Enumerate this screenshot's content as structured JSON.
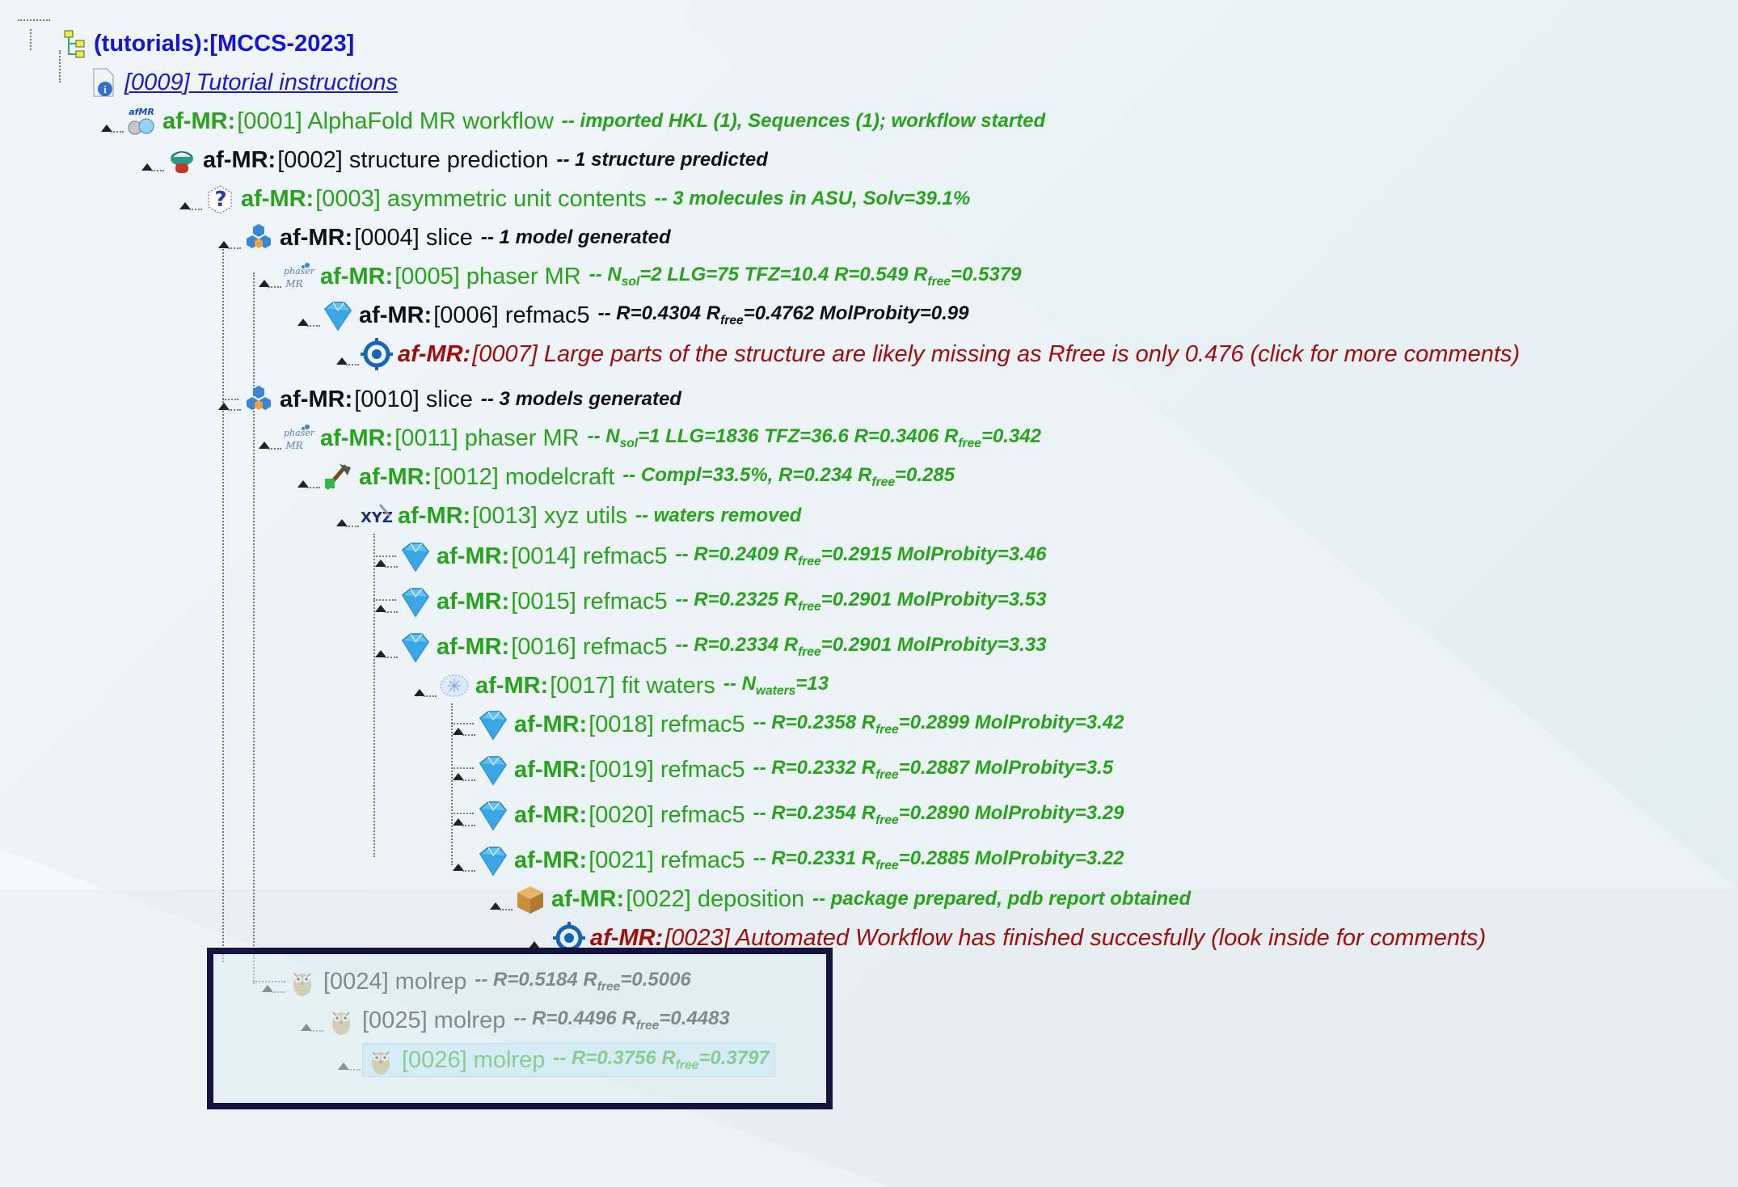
{
  "root": {
    "label": "(tutorials):[MCCS-2023]"
  },
  "instructions_link": {
    "label": "[0009] Tutorial instructions"
  },
  "nodes": [
    {
      "id": "0001",
      "prefix": "af-MR:",
      "title": "[0001] AlphaFold MR workflow",
      "sep": " -- ",
      "summary": "imported HKL (1), Sequences (1); workflow started",
      "color": "green",
      "icon": "afmr-icon"
    },
    {
      "id": "0002",
      "prefix": "af-MR:",
      "title": "[0002] structure prediction",
      "sep": " -- ",
      "summary": "1 structure predicted",
      "color": "black",
      "icon": "structure-prediction-icon"
    },
    {
      "id": "0003",
      "prefix": "af-MR:",
      "title": "[0003] asymmetric unit contents",
      "sep": " -- ",
      "summary": "3 molecules in ASU, Solv=39.1%",
      "color": "green",
      "icon": "asu-question-icon"
    },
    {
      "id": "0004",
      "prefix": "af-MR:",
      "title": "[0004] slice",
      "sep": " -- ",
      "summary": "1 model generated",
      "color": "black",
      "icon": "slice-icon"
    },
    {
      "id": "0005",
      "prefix": "af-MR:",
      "title": "[0005] phaser MR",
      "sep": " -- ",
      "summary_html": "N<sub>sol</sub>=2 LLG=75 TFZ=10.4 R=0.549 R<sub>free</sub>=0.5379",
      "color": "green",
      "icon": "phaser-icon"
    },
    {
      "id": "0006",
      "prefix": "af-MR:",
      "title": "[0006] refmac5",
      "sep": " -- ",
      "summary_html": "R=0.4304 R<sub>free</sub>=0.4762 MolProbity=0.99",
      "color": "black",
      "icon": "refmac-icon"
    },
    {
      "id": "0007",
      "prefix": "af-MR:",
      "title": "[0007] Large parts of the structure are likely missing as Rfree is only 0.476 (click for more comments)",
      "sep": "",
      "summary": "",
      "color": "red",
      "icon": "comments-target-icon"
    },
    {
      "id": "0010",
      "prefix": "af-MR:",
      "title": "[0010] slice",
      "sep": " -- ",
      "summary": "3 models generated",
      "color": "black",
      "icon": "slice-icon"
    },
    {
      "id": "0011",
      "prefix": "af-MR:",
      "title": "[0011] phaser MR",
      "sep": " -- ",
      "summary_html": "N<sub>sol</sub>=1 LLG=1836 TFZ=36.6 R=0.3406 R<sub>free</sub>=0.342",
      "color": "green",
      "icon": "phaser-icon"
    },
    {
      "id": "0012",
      "prefix": "af-MR:",
      "title": "[0012] modelcraft",
      "sep": " -- ",
      "summary_html": "Compl=33.5%, R=0.234 R<sub>free</sub>=0.285",
      "color": "green",
      "icon": "modelcraft-icon"
    },
    {
      "id": "0013",
      "prefix": "af-MR:",
      "title": "[0013] xyz utils",
      "sep": " -- ",
      "summary": "waters removed",
      "color": "green",
      "icon": "xyz-utils-icon"
    },
    {
      "id": "0014",
      "prefix": "af-MR:",
      "title": "[0014] refmac5",
      "sep": " -- ",
      "summary_html": "R=0.2409 R<sub>free</sub>=0.2915 MolProbity=3.46",
      "color": "green",
      "icon": "refmac-icon"
    },
    {
      "id": "0015",
      "prefix": "af-MR:",
      "title": "[0015] refmac5",
      "sep": " -- ",
      "summary_html": "R=0.2325 R<sub>free</sub>=0.2901 MolProbity=3.53",
      "color": "green",
      "icon": "refmac-icon"
    },
    {
      "id": "0016",
      "prefix": "af-MR:",
      "title": "[0016] refmac5",
      "sep": " -- ",
      "summary_html": "R=0.2334 R<sub>free</sub>=0.2901 MolProbity=3.33",
      "color": "green",
      "icon": "refmac-icon"
    },
    {
      "id": "0017",
      "prefix": "af-MR:",
      "title": "[0017] fit waters",
      "sep": " -- ",
      "summary_html": "N<sub>waters</sub>=13",
      "color": "green",
      "icon": "fit-waters-icon"
    },
    {
      "id": "0018",
      "prefix": "af-MR:",
      "title": "[0018] refmac5",
      "sep": " -- ",
      "summary_html": "R=0.2358 R<sub>free</sub>=0.2899 MolProbity=3.42",
      "color": "green",
      "icon": "refmac-icon"
    },
    {
      "id": "0019",
      "prefix": "af-MR:",
      "title": "[0019] refmac5",
      "sep": " -- ",
      "summary_html": "R=0.2332 R<sub>free</sub>=0.2887 MolProbity=3.5",
      "color": "green",
      "icon": "refmac-icon"
    },
    {
      "id": "0020",
      "prefix": "af-MR:",
      "title": "[0020] refmac5",
      "sep": " -- ",
      "summary_html": "R=0.2354 R<sub>free</sub>=0.2890 MolProbity=3.29",
      "color": "green",
      "icon": "refmac-icon"
    },
    {
      "id": "0021",
      "prefix": "af-MR:",
      "title": "[0021] refmac5",
      "sep": " -- ",
      "summary_html": "R=0.2331 R<sub>free</sub>=0.2885 MolProbity=3.22",
      "color": "green",
      "icon": "refmac-icon"
    },
    {
      "id": "0022",
      "prefix": "af-MR:",
      "title": "[0022] deposition",
      "sep": " -- ",
      "summary": "package prepared, pdb report obtained",
      "color": "green",
      "icon": "deposition-box-icon"
    },
    {
      "id": "0023",
      "prefix": "af-MR:",
      "title": "[0023] Automated Workflow has finished succesfully (look inside for comments)",
      "sep": "",
      "summary": "",
      "color": "red",
      "icon": "comments-target-icon"
    },
    {
      "id": "0024",
      "prefix": "",
      "title": "[0024] molrep",
      "sep": " -- ",
      "summary_html": "R=0.5184 R<sub>free</sub>=0.5006",
      "color": "black",
      "icon": "molrep-owl-icon"
    },
    {
      "id": "0025",
      "prefix": "",
      "title": "[0025] molrep",
      "sep": " -- ",
      "summary_html": "R=0.4496 R<sub>free</sub>=0.4483",
      "color": "black",
      "icon": "molrep-owl-icon"
    },
    {
      "id": "0026",
      "prefix": "",
      "title": "[0026] molrep",
      "sep": " -- ",
      "summary_html": "R=0.3756 R<sub>free</sub>=0.3797",
      "color": "green",
      "icon": "molrep-owl-icon",
      "selected": true
    }
  ]
}
